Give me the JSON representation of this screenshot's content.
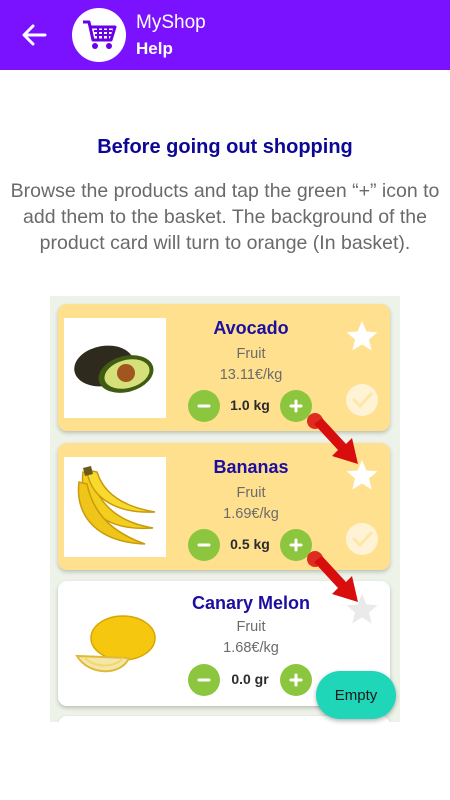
{
  "appbar": {
    "title": "MyShop",
    "subtitle": "Help",
    "back_icon": "arrow-left-icon",
    "logo_icon": "shopping-cart-icon",
    "color": "#7a12ff"
  },
  "help": {
    "heading": "Before going out shopping",
    "description": "Browse the products and tap the green “+” icon to add them to the basket. The background of the product card will turn to orange (In basket)."
  },
  "products": [
    {
      "name": "Avocado",
      "category": "Fruit",
      "price": "13.11€/kg",
      "quantity": "1.0 kg",
      "in_basket": true
    },
    {
      "name": "Bananas",
      "category": "Fruit",
      "price": "1.69€/kg",
      "quantity": "0.5 kg",
      "in_basket": true
    },
    {
      "name": "Canary Melon",
      "category": "Fruit",
      "price": "1.68€/kg",
      "quantity": "0.0 gr",
      "in_basket": false
    }
  ],
  "fab": {
    "label": "Empty",
    "color": "#1fd6b9"
  },
  "colors": {
    "in_basket": "#ffe08e",
    "plus_minus": "#8cc63f",
    "heading": "#0d0796",
    "arrow": "#d80d0d"
  }
}
